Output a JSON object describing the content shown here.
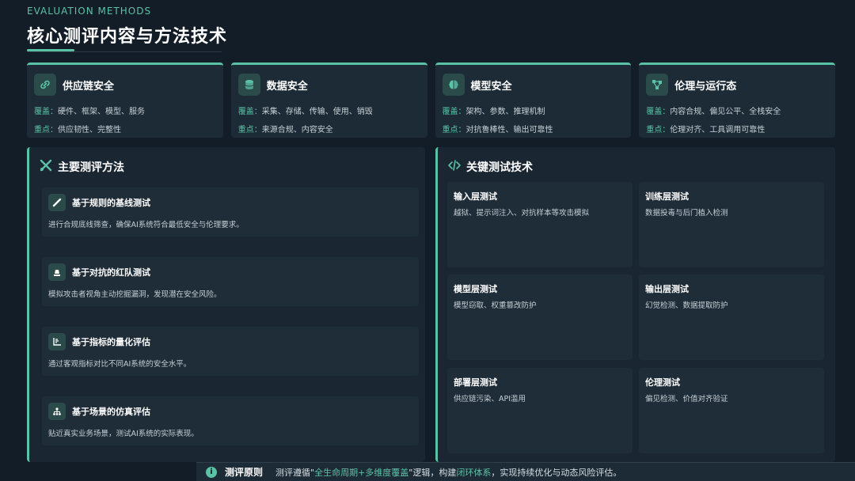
{
  "header": {
    "eyebrow": "EVALUATION METHODS",
    "title": "核心测评内容与方法技术"
  },
  "colors": {
    "accent": "#5cc2a6",
    "background": "#131d27",
    "card": "#1d2b36"
  },
  "cards": [
    {
      "icon": "link-icon",
      "title": "供应链安全",
      "cover_label": "覆盖：",
      "cover": "硬件、框架、模型、服务",
      "focus_label": "重点：",
      "focus": "供应韧性、完整性"
    },
    {
      "icon": "database-icon",
      "title": "数据安全",
      "cover_label": "覆盖：",
      "cover": "采集、存储、传输、使用、销毁",
      "focus_label": "重点：",
      "focus": "来源合规、内容安全"
    },
    {
      "icon": "brain-icon",
      "title": "模型安全",
      "cover_label": "覆盖：",
      "cover": "架构、参数、推理机制",
      "focus_label": "重点：",
      "focus": "对抗鲁棒性、输出可靠性"
    },
    {
      "icon": "network-icon",
      "title": "伦理与运行态",
      "cover_label": "覆盖：",
      "cover": "内容合规、偏见公平、全栈安全",
      "focus_label": "重点：",
      "focus": "伦理对齐、工具调用可靠性"
    }
  ],
  "methods_panel": {
    "icon": "tools-icon",
    "title": "主要测评方法",
    "items": [
      {
        "icon": "ruler-icon",
        "title": "基于规则的基线测试",
        "desc": "进行合规底线筛查，确保AI系统符合最低安全与伦理要求。"
      },
      {
        "icon": "user-secret-icon",
        "title": "基于对抗的红队测试",
        "desc": "模拟攻击者视角主动挖掘漏洞，发现潜在安全风险。"
      },
      {
        "icon": "chart-icon",
        "title": "基于指标的量化评估",
        "desc": "通过客观指标对比不同AI系统的安全水平。"
      },
      {
        "icon": "sitemap-icon",
        "title": "基于场景的仿真评估",
        "desc": "贴近真实业务场景，测试AI系统的实际表现。"
      }
    ]
  },
  "tech_panel": {
    "icon": "code-icon",
    "title": "关键测试技术",
    "items": [
      {
        "title": "输入层测试",
        "desc": "越狱、提示词注入、对抗样本等攻击模拟"
      },
      {
        "title": "训练层测试",
        "desc": "数据投毒与后门植入检测"
      },
      {
        "title": "模型层测试",
        "desc": "模型窃取、权重篡改防护"
      },
      {
        "title": "输出层测试",
        "desc": "幻觉检测、数据提取防护"
      },
      {
        "title": "部署层测试",
        "desc": "供应链污染、API滥用"
      },
      {
        "title": "伦理测试",
        "desc": "偏见检测、价值对齐验证"
      }
    ]
  },
  "principle": {
    "icon": "info-icon",
    "label": "测评原则",
    "text_1": "测评遵循\"",
    "highlight_1": "全生命周期+多维度覆盖",
    "text_2": "\"逻辑，构建",
    "highlight_2": "闭环体系",
    "text_3": "，实现持续优化与动态风险评估。"
  }
}
